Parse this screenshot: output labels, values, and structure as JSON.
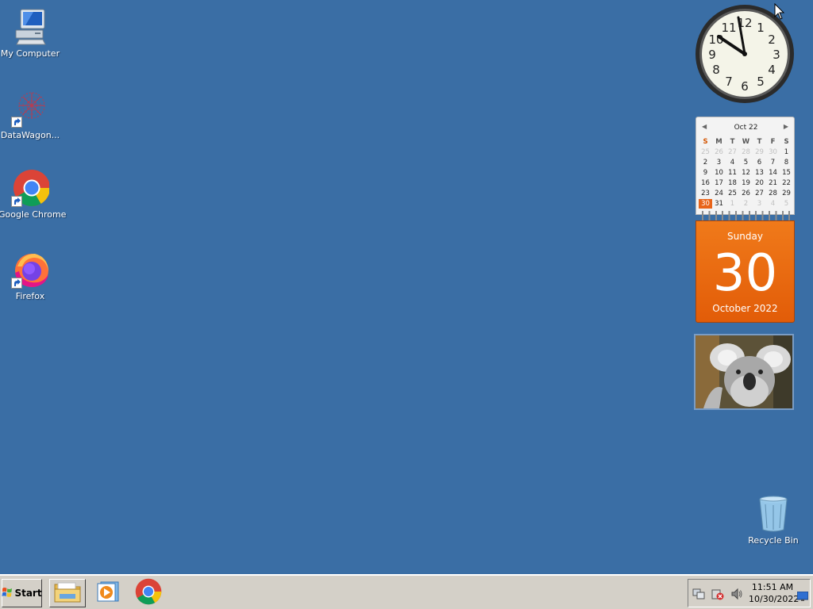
{
  "desktop": {
    "icons": [
      {
        "label": "My Computer",
        "icon": "my-computer-icon"
      },
      {
        "label": "DataWagon...",
        "icon": "datawagon-icon",
        "shortcut": true
      },
      {
        "label": "Google Chrome",
        "icon": "chrome-icon",
        "shortcut": true
      },
      {
        "label": "Firefox",
        "icon": "firefox-icon",
        "shortcut": true
      }
    ],
    "recycle_bin": {
      "label": "Recycle Bin",
      "icon": "recycle-bin-icon"
    },
    "background_color": "#3a6ea5"
  },
  "gadgets": {
    "clock": {
      "time_shown": "11:51"
    },
    "calendar": {
      "header": "Oct 22",
      "weekdays": [
        "S",
        "M",
        "T",
        "W",
        "T",
        "F",
        "S"
      ],
      "weeks": [
        [
          "25",
          "26",
          "27",
          "28",
          "29",
          "30",
          "1"
        ],
        [
          "2",
          "3",
          "4",
          "5",
          "6",
          "7",
          "8"
        ],
        [
          "9",
          "10",
          "11",
          "12",
          "13",
          "14",
          "15"
        ],
        [
          "16",
          "17",
          "18",
          "19",
          "20",
          "21",
          "22"
        ],
        [
          "23",
          "24",
          "25",
          "26",
          "27",
          "28",
          "29"
        ],
        [
          "30",
          "31",
          "1",
          "2",
          "3",
          "4",
          "5"
        ]
      ],
      "today": "30",
      "day_name": "Sunday",
      "day_number": "30",
      "month_year": "October 2022",
      "accent": "#e8641a"
    },
    "slideshow": {
      "subject": "koala"
    }
  },
  "taskbar": {
    "start_label": "Start",
    "pinned": [
      {
        "icon": "file-explorer-icon",
        "active": true
      },
      {
        "icon": "media-player-icon",
        "active": false
      },
      {
        "icon": "chrome-icon",
        "active": false
      }
    ],
    "tray": {
      "icons": [
        "network-icon",
        "security-icon",
        "volume-icon"
      ],
      "time": "11:51 AM",
      "date": "10/30/2022"
    }
  }
}
